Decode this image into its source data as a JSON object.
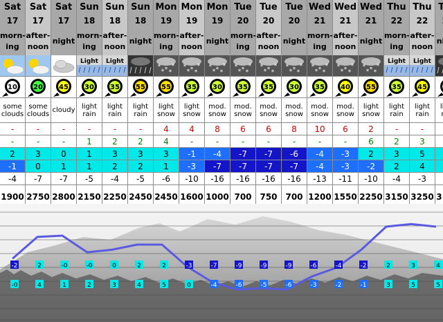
{
  "columns": [
    {
      "day": "Sat",
      "date": "17",
      "period": "morning",
      "icon": "sun-cloud-icon",
      "wind": "10",
      "summary": "some clouds",
      "snow": "-",
      "rain": "-",
      "max": "2",
      "min": "-1",
      "chill": "-4",
      "freezing": "1900"
    },
    {
      "day": "Sat",
      "date": "17",
      "period": "afternoon",
      "icon": "sun-cloud-icon",
      "wind": "20",
      "summary": "some clouds",
      "snow": "-",
      "rain": "-",
      "max": "3",
      "min": "0",
      "chill": "-7",
      "freezing": "2750"
    },
    {
      "day": "Sat",
      "date": "17",
      "period": "night",
      "icon": "cloud-icon",
      "wind": "45",
      "summary": "cloudy",
      "snow": "-",
      "rain": "-",
      "max": "0",
      "min": "1",
      "chill": "-7",
      "freezing": "2800"
    },
    {
      "day": "Sun",
      "date": "18",
      "period": "morning",
      "icon": "light-rain-icon",
      "wind": "30",
      "summary": "light rain",
      "snow": "-",
      "rain": "1",
      "max": "1",
      "min": "1",
      "chill": "-5",
      "freezing": "2150"
    },
    {
      "day": "Sun",
      "date": "18",
      "period": "afternoon",
      "icon": "light-rain-icon",
      "wind": "35",
      "summary": "light rain",
      "snow": "-",
      "rain": "2",
      "max": "3",
      "min": "2",
      "chill": "-4",
      "freezing": "2250"
    },
    {
      "day": "Sun",
      "date": "18",
      "period": "night",
      "icon": "rain-night-icon",
      "wind": "55",
      "summary": "light rain",
      "snow": "-",
      "rain": "2",
      "max": "3",
      "min": "2",
      "chill": "-5",
      "freezing": "2450"
    },
    {
      "day": "Mon",
      "date": "19",
      "period": "morning",
      "icon": "snow-icon",
      "wind": "55",
      "summary": "light snow",
      "snow": "4",
      "rain": "4",
      "max": "3",
      "min": "1",
      "chill": "-6",
      "freezing": "2450"
    },
    {
      "day": "Mon",
      "date": "19",
      "period": "afternoon",
      "icon": "snow-icon",
      "wind": "35",
      "summary": "light snow",
      "snow": "4",
      "rain": "-",
      "max": "-1",
      "min": "-3",
      "chill": "-10",
      "freezing": "1600"
    },
    {
      "day": "Mon",
      "date": "19",
      "period": "night",
      "icon": "snow-icon",
      "wind": "30",
      "summary": "mod. snow",
      "snow": "8",
      "rain": "-",
      "max": "-4",
      "min": "-7",
      "chill": "-16",
      "freezing": "1000"
    },
    {
      "day": "Tue",
      "date": "20",
      "period": "morning",
      "icon": "snow-icon",
      "wind": "35",
      "summary": "mod. snow",
      "snow": "6",
      "rain": "-",
      "max": "-7",
      "min": "-7",
      "chill": "-16",
      "freezing": "700"
    },
    {
      "day": "Tue",
      "date": "20",
      "period": "afternoon",
      "icon": "snow-icon",
      "wind": "35",
      "summary": "mod. snow",
      "snow": "6",
      "rain": "-",
      "max": "-7",
      "min": "-7",
      "chill": "-16",
      "freezing": "750"
    },
    {
      "day": "Tue",
      "date": "20",
      "period": "night",
      "icon": "snow-icon",
      "wind": "30",
      "summary": "mod. snow",
      "snow": "8",
      "rain": "-",
      "max": "-6",
      "min": "-7",
      "chill": "-16",
      "freezing": "700"
    },
    {
      "day": "Wed",
      "date": "21",
      "period": "morning",
      "icon": "snow-icon",
      "wind": "35",
      "summary": "mod. snow",
      "snow": "10",
      "rain": "-",
      "max": "-4",
      "min": "-4",
      "chill": "-13",
      "freezing": "1200"
    },
    {
      "day": "Wed",
      "date": "21",
      "period": "afternoon",
      "icon": "snow-icon",
      "wind": "40",
      "summary": "mod. snow",
      "snow": "6",
      "rain": "-",
      "max": "-3",
      "min": "-3",
      "chill": "-11",
      "freezing": "1550"
    },
    {
      "day": "Wed",
      "date": "21",
      "period": "night",
      "icon": "snow-icon",
      "wind": "55",
      "summary": "light snow",
      "snow": "2",
      "rain": "6",
      "max": "2",
      "min": "-2",
      "chill": "-10",
      "freezing": "2250"
    },
    {
      "day": "Thu",
      "date": "22",
      "period": "morning",
      "icon": "light-rain-icon",
      "wind": "35",
      "summary": "light rain",
      "snow": "-",
      "rain": "2",
      "max": "3",
      "min": "2",
      "chill": "-4",
      "freezing": "3150"
    },
    {
      "day": "Thu",
      "date": "22",
      "period": "afternoon",
      "icon": "light-rain-icon",
      "wind": "45",
      "summary": "light rain",
      "snow": "-",
      "rain": "3",
      "max": "5",
      "min": "4",
      "chill": "-3",
      "freezing": "3250"
    },
    {
      "day": "Thu",
      "date": "22",
      "period": "night",
      "icon": "rain-night-icon",
      "wind": "55",
      "summary": "light rain",
      "snow": "-",
      "rain": "8",
      "max": "5",
      "min": "4",
      "chill": "-3",
      "freezing": "3150"
    }
  ],
  "icon_label": "Light",
  "colors": {
    "header_morning": "#a8a8a8",
    "header_afternoon": "#c8c8c8",
    "header_night": "#a8a8a8",
    "line": "#5a5ae0",
    "temp_cyan": "#00e8e8",
    "temp_blue": "#1f6fff",
    "temp_dark_blue": "#1414c8"
  },
  "chart_data": {
    "type": "line",
    "categories": [
      "Sat 17 morning",
      "Sat 17 afternoon",
      "Sat 17 night",
      "Sun 18 morning",
      "Sun 18 afternoon",
      "Sun 18 night",
      "Mon 19 morning",
      "Mon 19 afternoon",
      "Mon 19 night",
      "Tue 20 morning",
      "Tue 20 afternoon",
      "Tue 20 night",
      "Wed 21 morning",
      "Wed 21 afternoon",
      "Wed 21 night",
      "Thu 22 morning",
      "Thu 22 afternoon",
      "Thu 22 night"
    ],
    "line_values": [
      1900,
      2750,
      2800,
      2150,
      2250,
      2450,
      2450,
      1600,
      1000,
      700,
      750,
      700,
      1200,
      1550,
      2250,
      3150,
      3250,
      3150
    ],
    "upper_labels": [
      "-2",
      "2",
      "-0",
      "-0",
      "0",
      "2",
      "2",
      "-3",
      "-7",
      "-9",
      "-9",
      "-9",
      "-6",
      "-4",
      "-2",
      "2",
      "3",
      "4"
    ],
    "lower_labels": [
      "-0",
      "4",
      "1",
      "2",
      "3",
      "4",
      "5",
      "0",
      "-4",
      "-6",
      "-5",
      "-6",
      "-3",
      "-2",
      "-1",
      "3",
      "5",
      "5"
    ],
    "ylim": [
      0,
      3500
    ],
    "grid": true
  }
}
